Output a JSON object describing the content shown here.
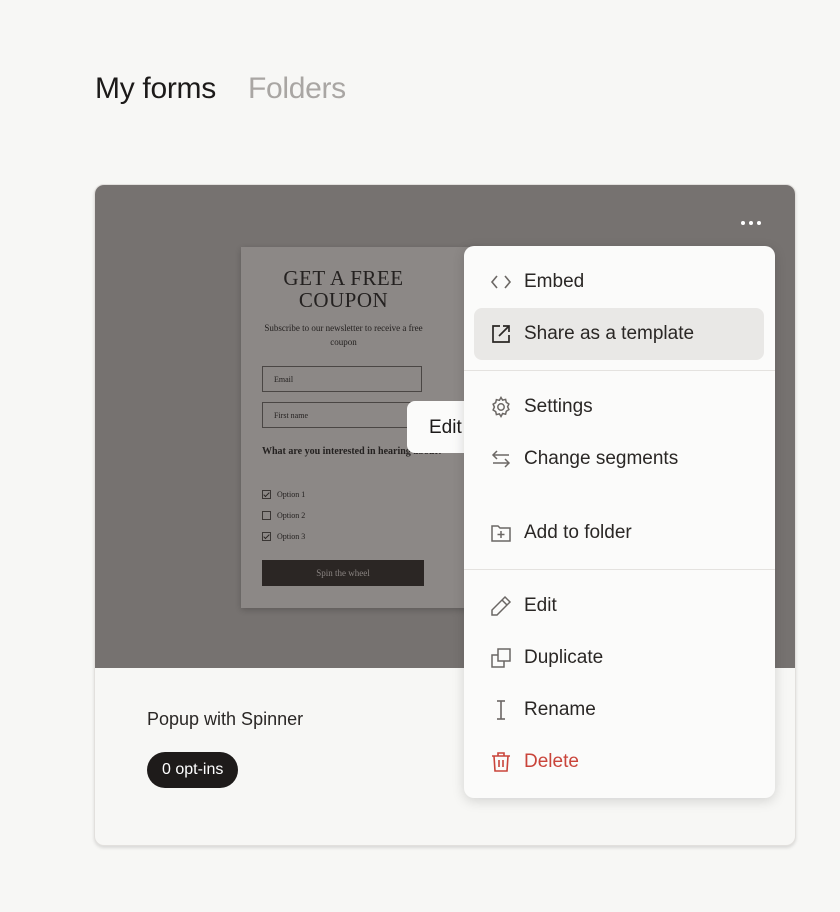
{
  "tabs": [
    {
      "label": "My forms"
    },
    {
      "label": "Folders"
    }
  ],
  "form_card": {
    "name": "Popup with Spinner",
    "badge": "0 opt-ins",
    "edit_label": "Edit",
    "more_icon": "more-horizontal-icon",
    "preview": {
      "title_line1": "GET A FREE",
      "title_line2": "COUPON",
      "subtitle": "Subscribe to our newsletter to receive a free coupon",
      "email_placeholder": "Email",
      "firstname_placeholder": "First name",
      "question": "What are you interested in hearing about?",
      "options": [
        {
          "label": "Option 1",
          "checked": true
        },
        {
          "label": "Option 2",
          "checked": false
        },
        {
          "label": "Option 3",
          "checked": true
        }
      ],
      "button": "Spin the wheel"
    }
  },
  "menu": {
    "items": [
      {
        "label": "Embed",
        "icon": "code-icon"
      },
      {
        "label": "Share as a template",
        "icon": "external-link-icon",
        "highlighted": true
      },
      {
        "label": "Settings",
        "icon": "gear-icon"
      },
      {
        "label": "Change segments",
        "icon": "swap-arrows-icon"
      },
      {
        "label": "Add to folder",
        "icon": "folder-plus-icon"
      },
      {
        "label": "Edit",
        "icon": "pencil-icon"
      },
      {
        "label": "Duplicate",
        "icon": "duplicate-icon"
      },
      {
        "label": "Rename",
        "icon": "text-cursor-icon"
      },
      {
        "label": "Delete",
        "icon": "trash-icon",
        "danger": true
      }
    ]
  },
  "colors": {
    "preview_bg": "#767270",
    "danger": "#c9443a",
    "badge_bg": "#1e1b1a",
    "highlight": "#e9e8e6"
  }
}
